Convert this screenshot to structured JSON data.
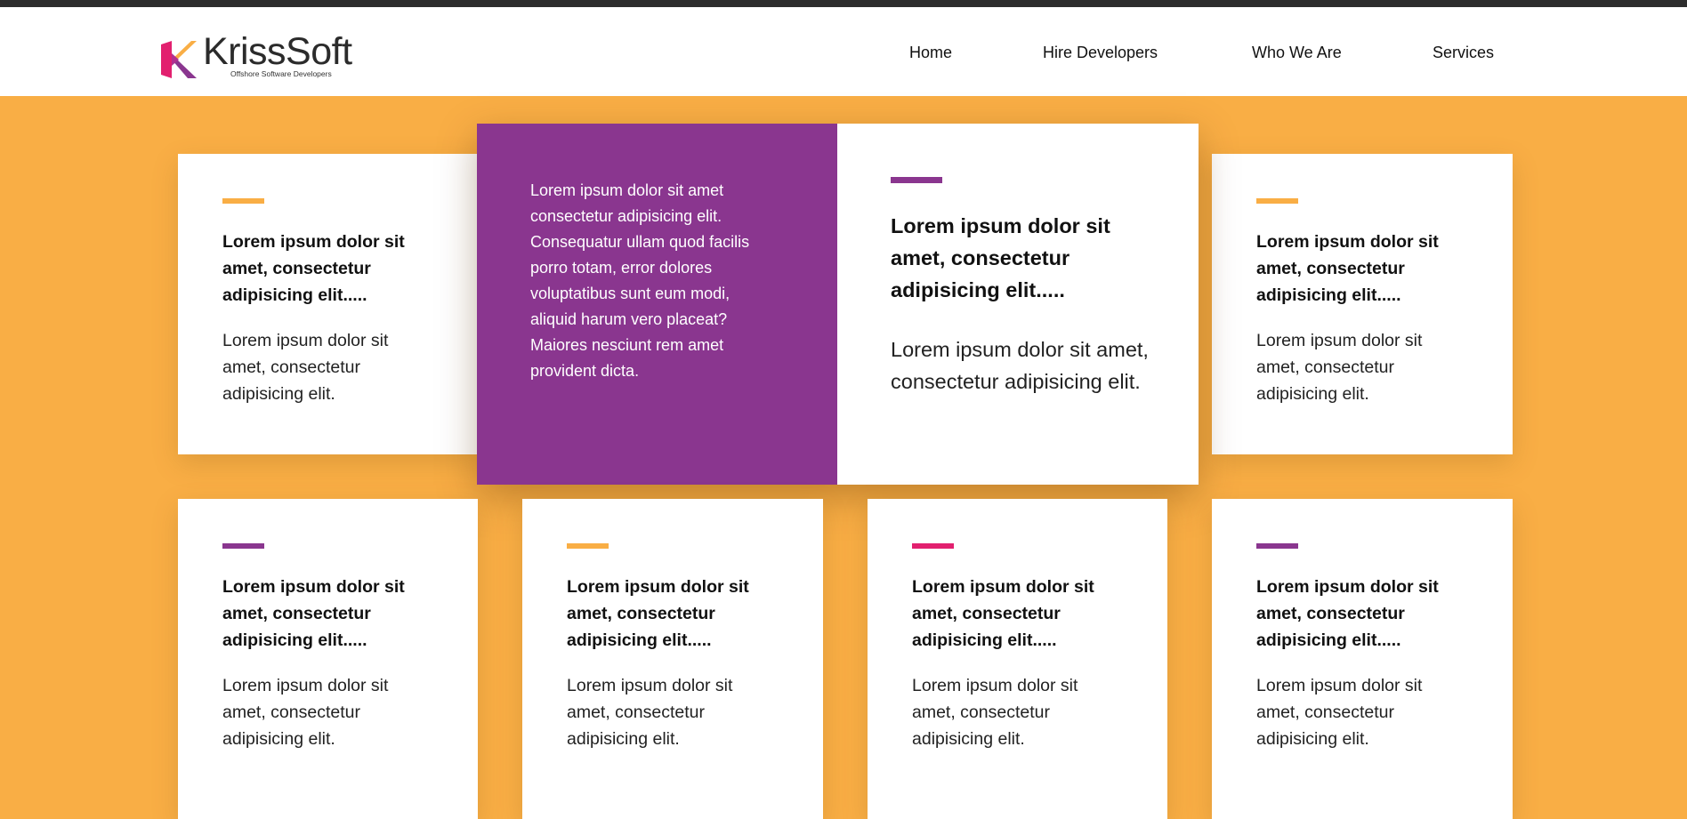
{
  "header": {
    "logo": {
      "name": "KrissSoft",
      "tagline": "Offshore Software Developers"
    },
    "nav": [
      "Home",
      "Hire Developers",
      "Who We Are",
      "Services"
    ]
  },
  "colors": {
    "background": "#f9ae45",
    "purple": "#8a368f",
    "orange": "#f9ae45",
    "pink": "#e2206f"
  },
  "hero": {
    "text": "Lorem ipsum dolor sit amet consectetur adipisicing elit. Consequatur ullam quod facilis porro totam, error dolores voluptatibus sunt eum modi, aliquid harum vero placeat? Maiores nesciunt rem amet provident dicta.",
    "title": "Lorem ipsum dolor sit amet, consectetur adipisicing elit.....",
    "body": "Lorem ipsum dolor sit amet, consectetur adipisicing elit.",
    "accent": "purple"
  },
  "cards": [
    {
      "title": "Lorem ipsum dolor sit amet, consectetur adipisicing elit.....",
      "body": "Lorem ipsum dolor sit amet, consectetur adipisicing elit.",
      "accent": "orange"
    },
    {
      "title": "Lorem ipsum dolor sit amet, consectetur adipisicing elit.....",
      "body": "Lorem ipsum dolor sit amet, consectetur adipisicing elit.",
      "accent": "orange"
    },
    {
      "title": "Lorem ipsum dolor sit amet, consectetur adipisicing elit.....",
      "body": "Lorem ipsum dolor sit amet, consectetur adipisicing elit.",
      "accent": "purple"
    },
    {
      "title": "Lorem ipsum dolor sit amet, consectetur adipisicing elit.....",
      "body": "Lorem ipsum dolor sit amet, consectetur adipisicing elit.",
      "accent": "orange"
    },
    {
      "title": "Lorem ipsum dolor sit amet, consectetur adipisicing elit.....",
      "body": "Lorem ipsum dolor sit amet, consectetur adipisicing elit.",
      "accent": "pink"
    },
    {
      "title": "Lorem ipsum dolor sit amet, consectetur adipisicing elit.....",
      "body": "Lorem ipsum dolor sit amet, consectetur adipisicing elit.",
      "accent": "purple"
    }
  ]
}
